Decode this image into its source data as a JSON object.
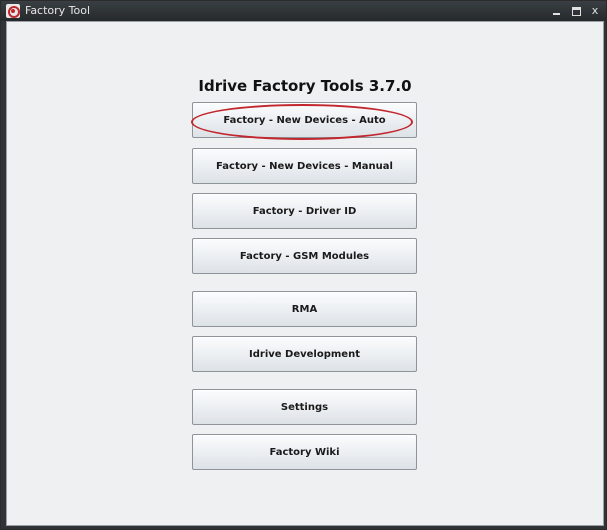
{
  "window": {
    "title": "Factory Tool",
    "controls": {
      "minimize_icon": "minimize-icon",
      "maximize_icon": "maximize-icon",
      "close_icon": "close-icon",
      "close_glyph": "x"
    }
  },
  "main": {
    "heading": "Idrive Factory Tools 3.7.0",
    "buttons": [
      {
        "label": "Factory - New Devices - Auto",
        "highlighted": true
      },
      {
        "label": "Factory - New Devices - Manual"
      },
      {
        "label": "Factory - Driver ID"
      },
      {
        "label": "Factory - GSM Modules"
      },
      {
        "label": "RMA"
      },
      {
        "label": "Idrive Development"
      },
      {
        "label": "Settings"
      },
      {
        "label": "Factory Wiki"
      }
    ]
  },
  "colors": {
    "highlight": "#c1272d",
    "titlebar": "#2f3336",
    "background": "#eef0f2"
  }
}
